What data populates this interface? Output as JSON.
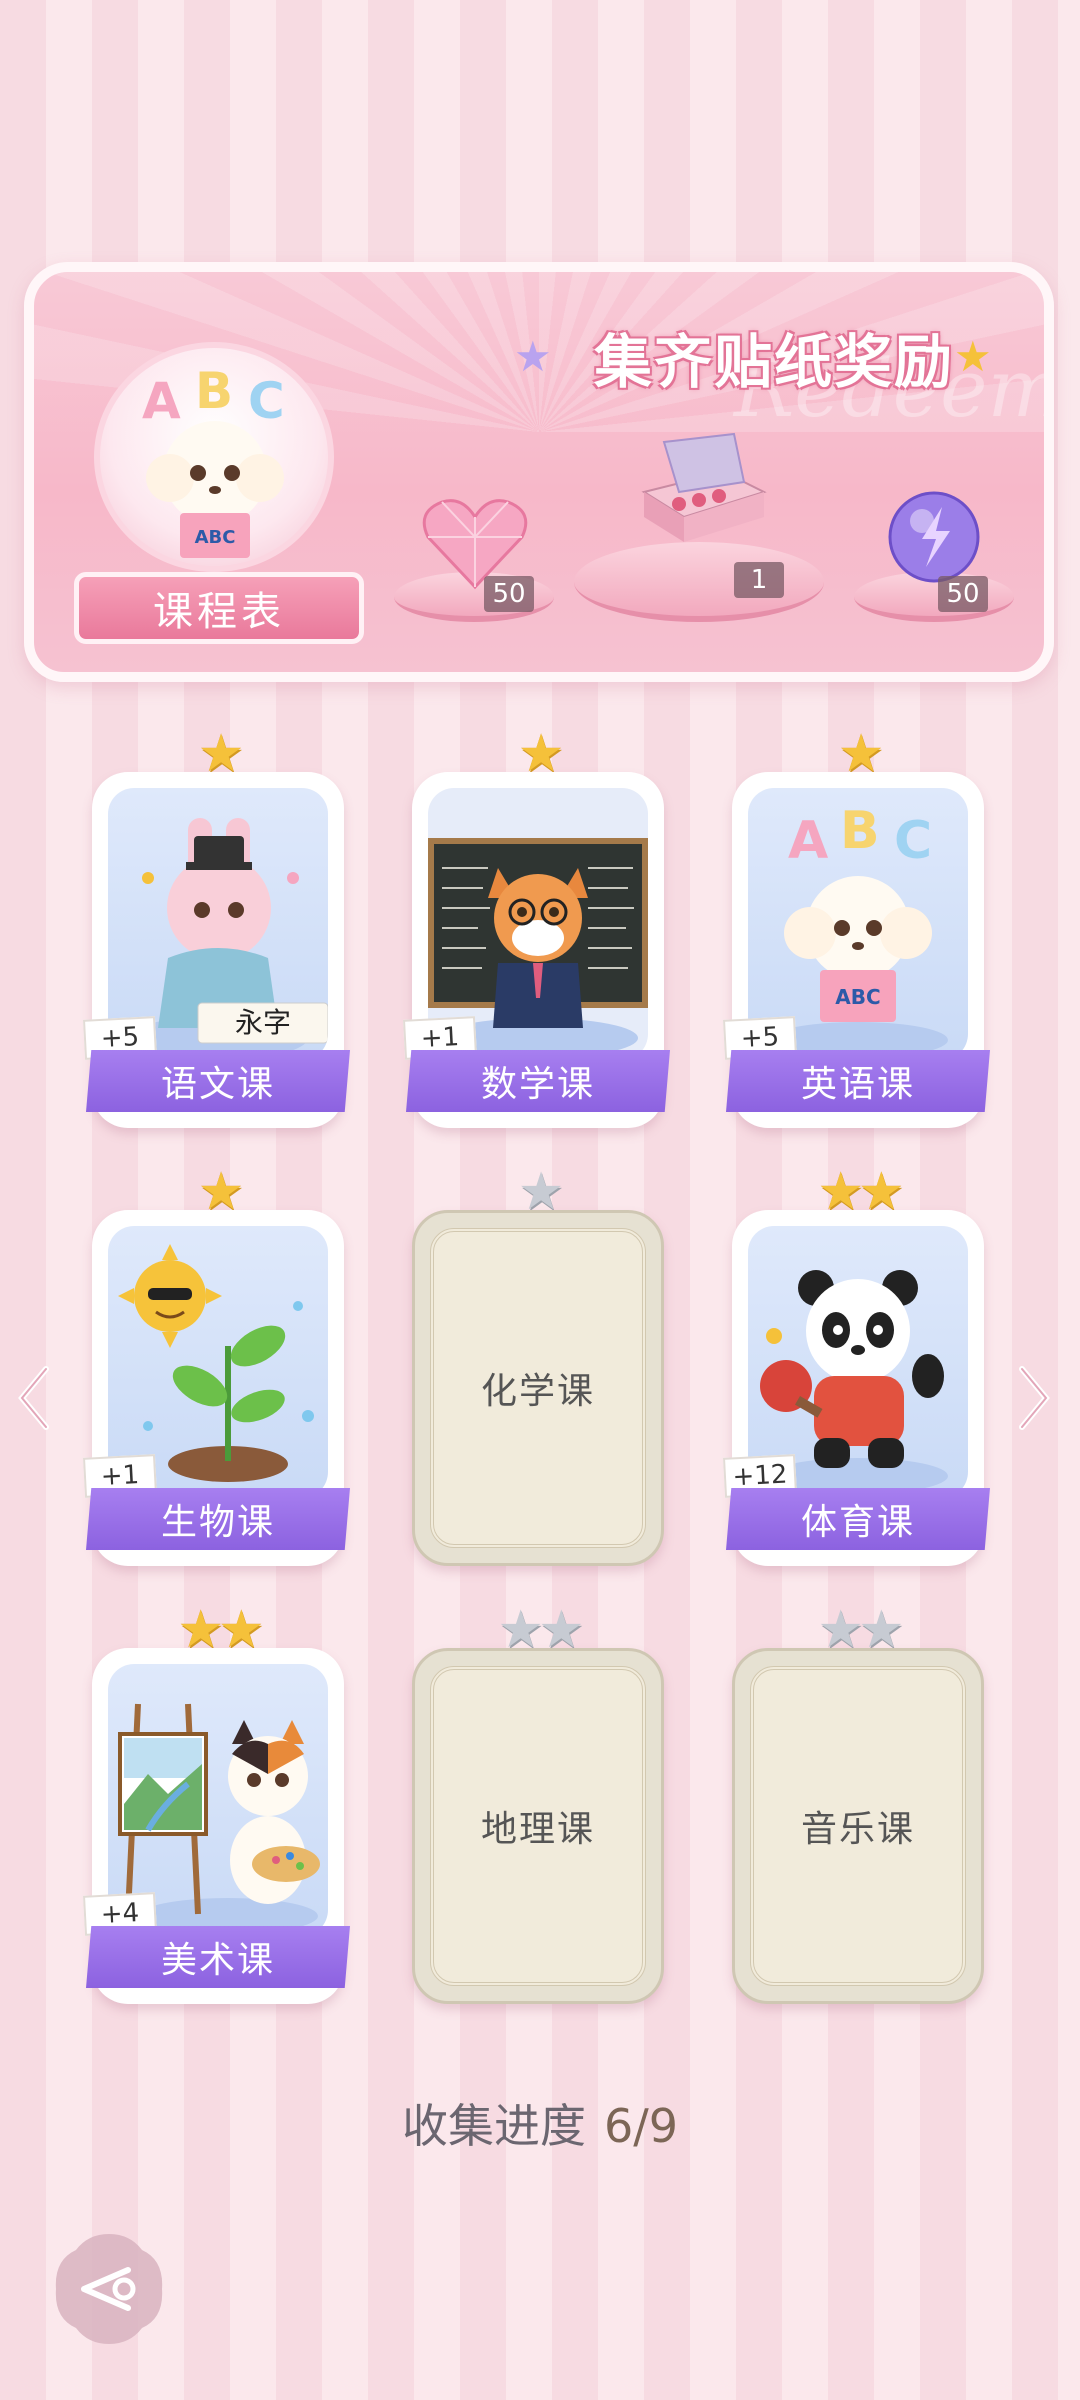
{
  "banner": {
    "title": "集齐贴纸奖励",
    "watermark": "Redeem",
    "schedule_label": "课程表",
    "rewards": [
      {
        "icon": "heart-gem-icon",
        "count": "50"
      },
      {
        "icon": "gift-box-icon",
        "count": "1"
      },
      {
        "icon": "lightning-orb-icon",
        "count": "50"
      }
    ]
  },
  "cards": [
    {
      "name": "语文课",
      "stars": 1,
      "bonus": "+5",
      "unlocked": true,
      "art": "bunny-calligraphy"
    },
    {
      "name": "数学课",
      "stars": 1,
      "bonus": "+1",
      "unlocked": true,
      "art": "fox-teacher"
    },
    {
      "name": "英语课",
      "stars": 1,
      "bonus": "+5",
      "unlocked": true,
      "art": "poodle-abc"
    },
    {
      "name": "生物课",
      "stars": 1,
      "bonus": "+1",
      "unlocked": true,
      "art": "sun-sprout"
    },
    {
      "name": "化学课",
      "stars": 1,
      "bonus": "",
      "unlocked": false,
      "art": ""
    },
    {
      "name": "体育课",
      "stars": 2,
      "bonus": "+12",
      "unlocked": true,
      "art": "panda-pingpong"
    },
    {
      "name": "美术课",
      "stars": 2,
      "bonus": "+4",
      "unlocked": true,
      "art": "cat-painter"
    },
    {
      "name": "地理课",
      "stars": 2,
      "bonus": "",
      "unlocked": false,
      "art": ""
    },
    {
      "name": "音乐课",
      "stars": 2,
      "bonus": "",
      "unlocked": false,
      "art": ""
    }
  ],
  "progress": {
    "label": "收集进度",
    "value": "6/9"
  },
  "colors": {
    "ribbon": "#9a70ea",
    "star_gold": "#f5c13a",
    "star_gray": "#c7cbd3",
    "banner_pink": "#f7b8c9"
  }
}
